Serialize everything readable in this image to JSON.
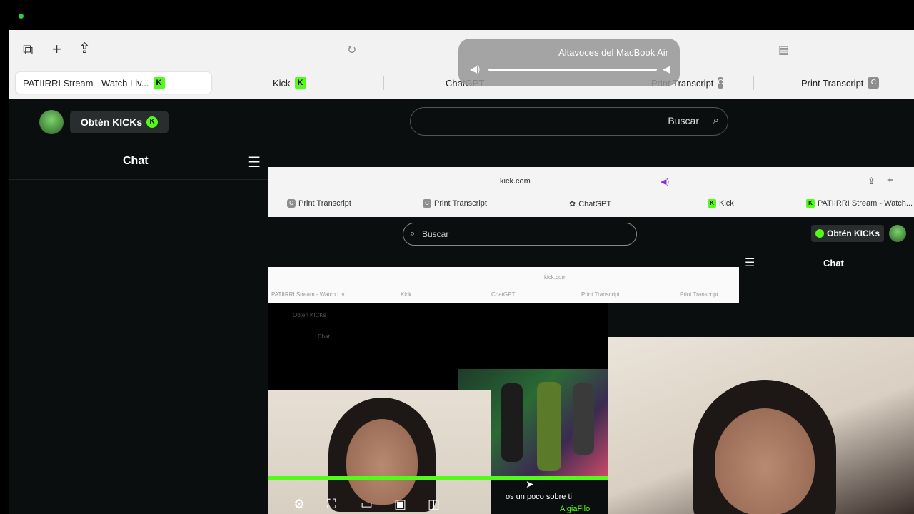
{
  "browser": {
    "tabs": [
      {
        "label": "PATIIRRI Stream - Watch Liv...",
        "icon": "kick-logo"
      },
      {
        "label": "Kick",
        "icon": "kick-logo"
      },
      {
        "label": "ChatGPT",
        "icon": "chatgpt-logo"
      },
      {
        "label": "Print Transcript",
        "icon": "c-badge"
      },
      {
        "label": "Print Transcript",
        "icon": "c-badge"
      }
    ]
  },
  "audio_popup": {
    "device": "Altavoces del MacBook Air",
    "volume": 0.85
  },
  "kick": {
    "search_placeholder": "Buscar",
    "kicks_button": "Obtén KICKs",
    "chat_title": "Chat"
  },
  "nested": {
    "url": "kick.com",
    "tabs": [
      "Print Transcript",
      "Print Transcript",
      "ChatGPT",
      "Kick",
      "PATIIRRI Stream - Watch..."
    ],
    "search_placeholder": "Buscar",
    "kicks_button": "Obtén KICKs",
    "chat_title": "Chat"
  },
  "deep_nested": {
    "url": "kick.com",
    "tabs": [
      "PATIIRRI Stream - Watch Liv",
      "Kick",
      "ChatGPT",
      "Print Transcript",
      "Print Transcript"
    ],
    "kicks_button": "Obtén KICKs",
    "chat_title": "Chat"
  },
  "video": {
    "progress": 1.0,
    "subtitle": "os un poco sobre ti",
    "username": "AlgiaFllo"
  },
  "colors": {
    "accent": "#53fc18",
    "background": "#0b0e0f"
  }
}
